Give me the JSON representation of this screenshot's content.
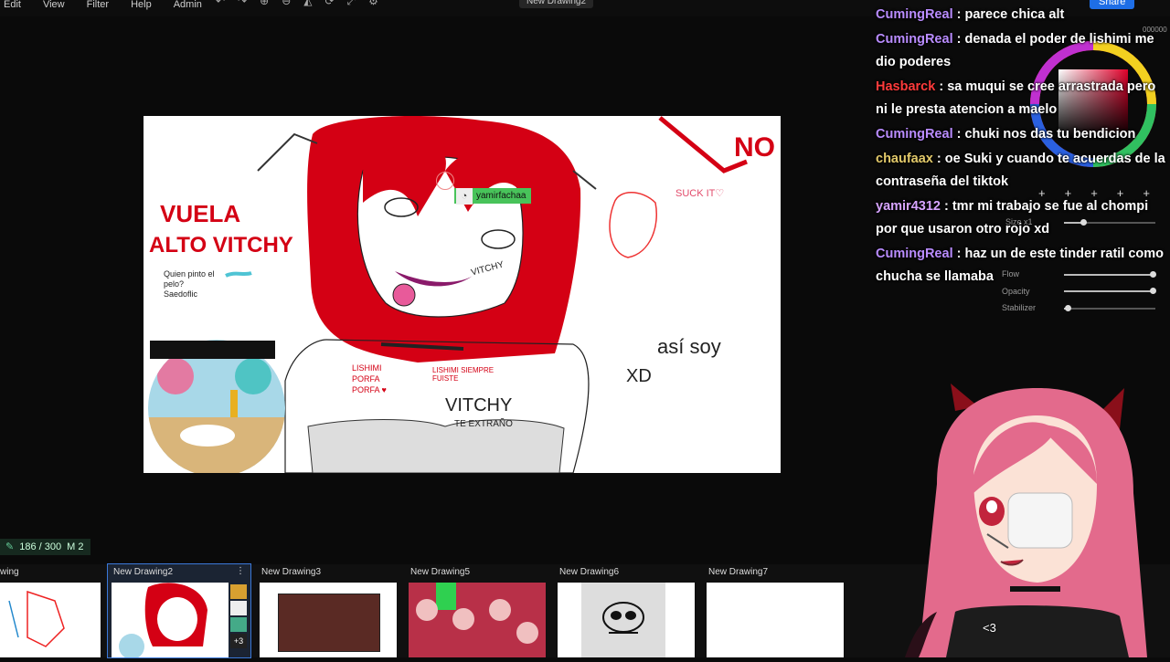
{
  "menubar": {
    "menus": [
      "Edit",
      "View",
      "Filter",
      "Help",
      "Admin"
    ],
    "document_title": "New Drawing2",
    "share_label": "Share"
  },
  "canvas": {
    "texts": {
      "vuela": "VUELA",
      "alto": "ALTO VITCHY",
      "no": "NO",
      "suck": "SUCK IT♡",
      "asi": "así soy",
      "xd": "XD",
      "quien": "Quien pinto el pelo? Saedoflic",
      "vitchy_chest": "VITCHY",
      "te_extrano": "TE EXTRAÑO",
      "lishimi": "LISHIMI PORFA PORFA ♥",
      "lishimi_siempre": "LISHIMI SIEMPRE FUISTE",
      "vitchy_face": "VITCHY"
    },
    "cursor_user": "yamirfachaa"
  },
  "chat": {
    "messages": [
      {
        "user": "CumingReal",
        "color": "#b98cff",
        "text": "parece chica alt"
      },
      {
        "user": "CumingReal",
        "color": "#b98cff",
        "text": "denada el poder de lishimi me dio poderes"
      },
      {
        "user": "Hasbarck",
        "color": "#ff3b3b",
        "text": "sa muqui se cree arrastrada pero ni le presta atencion a maelo"
      },
      {
        "user": "CumingReal",
        "color": "#b98cff",
        "text": "chuki nos das tu bendicion"
      },
      {
        "user": "chaufaax",
        "color": "#e2c96a",
        "text": "oe Suki y cuando te acuerdas de la contraseña del tiktok"
      },
      {
        "user": "yamir4312",
        "color": "#d7a4ff",
        "text": "tmr mi trabajo se fue al chompi por que usaron otro rojo xd"
      },
      {
        "user": "CumingReal",
        "color": "#b98cff",
        "text": "haz un de este tinder ratil como chucha se llamaba"
      }
    ]
  },
  "brush_panel": {
    "size_label": "Size x1",
    "flow_label": "Flow",
    "opacity_label": "Opacity",
    "stabilizer_label": "Stabilizer",
    "slot_numbers": [
      "1",
      "2",
      "3",
      "4",
      "5"
    ],
    "hex_value": "000000"
  },
  "status": {
    "counter": "186 / 300",
    "mode": "M 2"
  },
  "drawings": [
    {
      "title": "wing"
    },
    {
      "title": "New Drawing2",
      "active": true,
      "badge": "+3"
    },
    {
      "title": "New Drawing3"
    },
    {
      "title": "New Drawing5"
    },
    {
      "title": "New Drawing6"
    },
    {
      "title": "New Drawing7"
    }
  ],
  "overlay": {
    "heart": "<3"
  },
  "colors": {
    "accent": "#1e6ee6",
    "paint_red": "#d40014",
    "background": "#0a0a0a"
  }
}
